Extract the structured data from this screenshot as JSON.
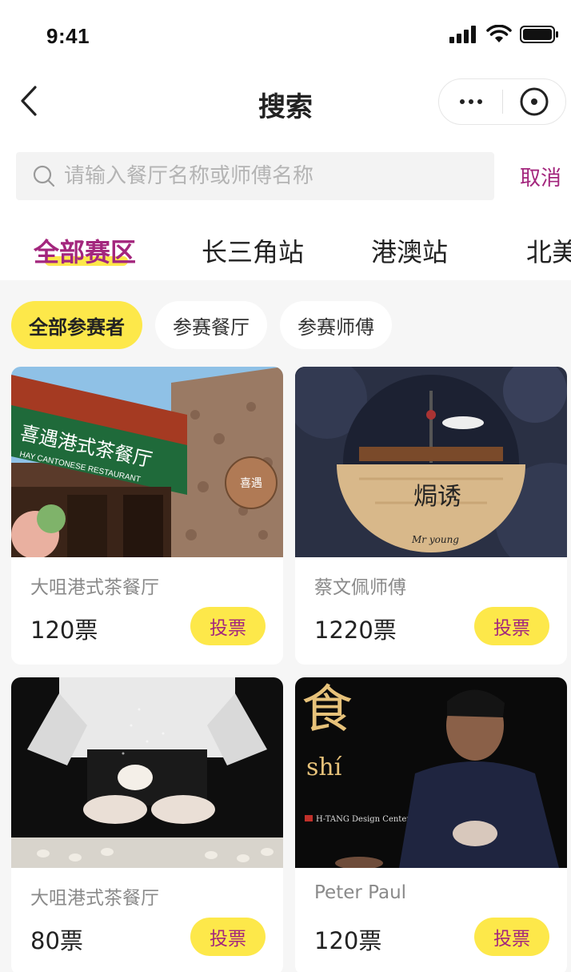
{
  "status_bar": {
    "time": "9:41"
  },
  "nav": {
    "title": "搜索"
  },
  "search": {
    "placeholder": "请输入餐厅名称或师傅名称",
    "value": "",
    "cancel_label": "取消"
  },
  "regions": [
    {
      "label": "全部赛区",
      "active": true
    },
    {
      "label": "长三角站",
      "active": false
    },
    {
      "label": "港澳站",
      "active": false
    },
    {
      "label": "北美站",
      "active": false
    }
  ],
  "filters": [
    {
      "label": "全部参赛者",
      "active": true
    },
    {
      "label": "参赛餐厅",
      "active": false
    },
    {
      "label": "参赛师傅",
      "active": false
    }
  ],
  "cards": [
    {
      "name": "大咀港式茶餐厅",
      "votes": "120票",
      "vote_label": "投票",
      "image_sign_text": "喜遇港式茶餐厅",
      "image_sign_sub": "HAY CANTONESE RESTAURANT",
      "image_plaque": "喜遇"
    },
    {
      "name": "蔡文佩师傅",
      "votes": "1220票",
      "vote_label": "投票",
      "image_title": "焗诱",
      "image_subtitle": "Mr young"
    },
    {
      "name": "大咀港式茶餐厅",
      "votes": "80票",
      "vote_label": "投票"
    },
    {
      "name": "Peter Paul",
      "votes": "120票",
      "vote_label": "投票",
      "image_title": "食",
      "image_subtitle": "shí",
      "image_caption": "H-TANG Design Center"
    }
  ],
  "colors": {
    "accent": "#a3267d",
    "highlight": "#fde84a",
    "background": "#f6f6f6"
  }
}
